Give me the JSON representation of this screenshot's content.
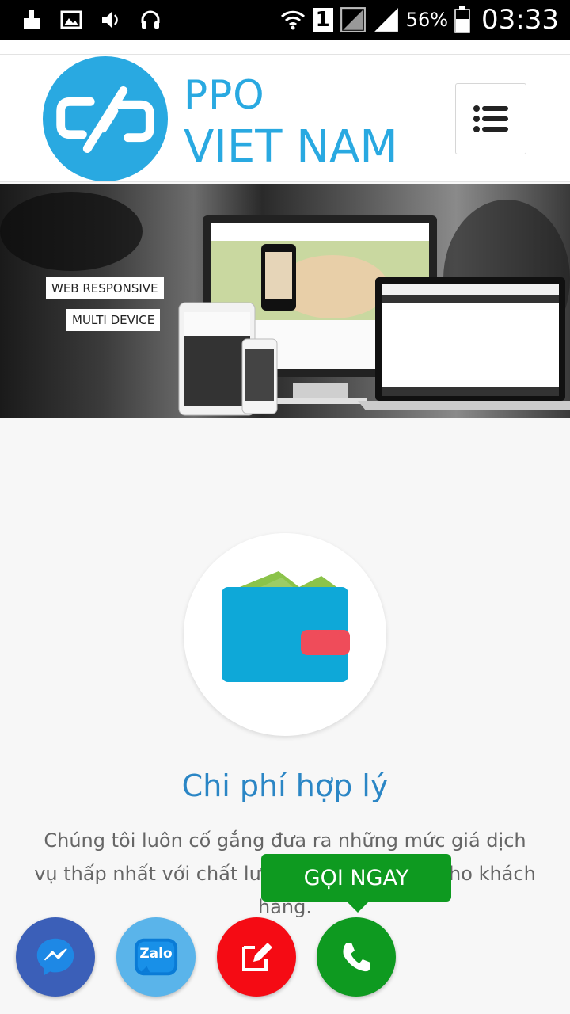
{
  "status_bar": {
    "battery": "56%",
    "time": "03:33",
    "sim_number": "1",
    "icons": [
      "cleaner-icon",
      "image-icon",
      "volume-icon",
      "headphones-icon",
      "wifi-icon",
      "sim-icon",
      "signal-icon",
      "battery-icon"
    ]
  },
  "header": {
    "logo_line1": "PPO",
    "logo_line2": "VIET NAM",
    "brand_color": "#29a9e1",
    "menu_icon": "hamburger-menu-icon"
  },
  "banner": {
    "tags": [
      "WEB RESPONSIVE",
      "MULTI DEVICE"
    ]
  },
  "feature": {
    "icon": "wallet-icon",
    "title": "Chi phí hợp lý",
    "description": "Chúng tôi luôn cố gắng đưa ra những mức giá dịch vụ thấp nhất với chất lượng tốt nhất dành cho khách hàng.",
    "title_color": "#2b86c5"
  },
  "floating": {
    "tooltip": "GỌI NGAY",
    "zalo_label": "Zalo",
    "buttons": [
      "messenger-icon",
      "zalo-icon",
      "edit-icon",
      "phone-icon"
    ]
  }
}
